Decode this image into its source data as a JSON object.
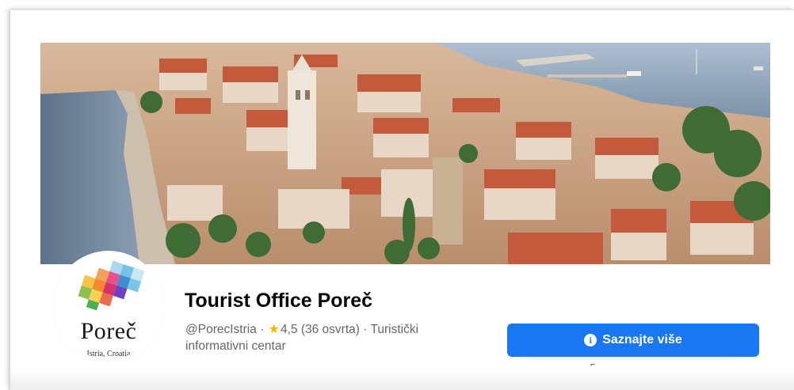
{
  "page": {
    "name": "Tourist Office Poreč",
    "handle": "@PorecIstria",
    "separator": "·",
    "rating": "4,5",
    "reviews": "(36 osvrta)",
    "category_line1": "Turistički",
    "category_line2": "informativni centar"
  },
  "avatar": {
    "title": "Poreč",
    "subtitle": "Istria, Croatia"
  },
  "cta": {
    "label": "Saznajte više",
    "icon": "info-icon"
  },
  "icons": {
    "star": "star-icon",
    "info": "info-icon",
    "cursor": "cursor-icon"
  },
  "colors": {
    "cta_background": "#1877f2",
    "star": "#f5b400",
    "secondary_text": "#65676b"
  }
}
